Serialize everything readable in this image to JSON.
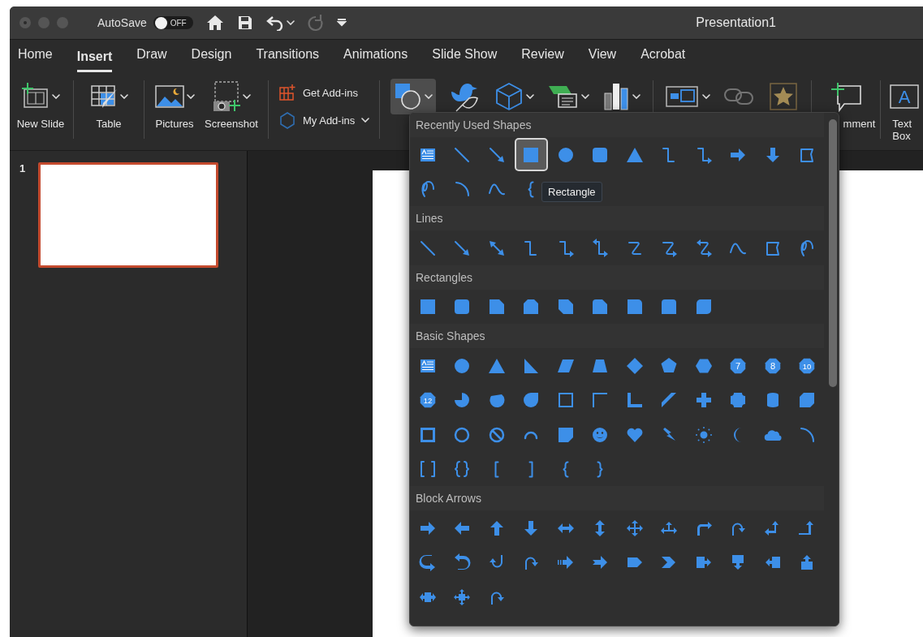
{
  "title_bar": {
    "autosave": {
      "label": "AutoSave",
      "toggle_text": "OFF",
      "on": false
    },
    "quick_access": [
      {
        "kind": "home",
        "disabled": false
      },
      {
        "kind": "save",
        "disabled": false
      },
      {
        "kind": "undo",
        "disabled": false,
        "menu": true
      },
      {
        "kind": "redo",
        "disabled": true,
        "menu": false
      },
      {
        "kind": "customize",
        "disabled": false
      }
    ],
    "title": "Presentation1"
  },
  "tabs": [
    {
      "label": "Home",
      "selected": false
    },
    {
      "label": "Insert",
      "selected": true
    },
    {
      "label": "Draw",
      "selected": false
    },
    {
      "label": "Design",
      "selected": false
    },
    {
      "label": "Transitions",
      "selected": false
    },
    {
      "label": "Animations",
      "selected": false
    },
    {
      "label": "Slide Show",
      "selected": false
    },
    {
      "label": "Review",
      "selected": false
    },
    {
      "label": "View",
      "selected": false
    },
    {
      "label": "Acrobat",
      "selected": false
    }
  ],
  "ribbon": [
    {
      "kind": "new-slide",
      "label": "New Slide",
      "menu": true,
      "selected": false,
      "disabled": false
    },
    {
      "kind": "separator"
    },
    {
      "kind": "table",
      "label": "Table",
      "menu": true,
      "selected": false,
      "disabled": false
    },
    {
      "kind": "separator"
    },
    {
      "kind": "pictures",
      "label": "Pictures",
      "menu": true,
      "selected": false,
      "disabled": false
    },
    {
      "kind": "screenshot",
      "label": "Screenshot",
      "menu": true,
      "selected": false,
      "disabled": false
    },
    {
      "kind": "separator"
    },
    {
      "kind": "addins",
      "items": [
        {
          "kind": "store",
          "label": "Get Add-ins",
          "menu": false
        },
        {
          "kind": "my-addins",
          "label": "My Add-ins",
          "menu": true
        }
      ]
    },
    {
      "kind": "separator"
    },
    {
      "kind": "shapes",
      "menu": true,
      "selected": true,
      "disabled": false
    },
    {
      "kind": "icons",
      "menu": false,
      "selected": false,
      "disabled": false
    },
    {
      "kind": "models",
      "menu": true,
      "selected": false,
      "disabled": false
    },
    {
      "kind": "smartart",
      "menu": true,
      "selected": false,
      "disabled": false
    },
    {
      "kind": "chart",
      "menu": true,
      "selected": false,
      "disabled": false
    },
    {
      "kind": "separator"
    },
    {
      "kind": "media",
      "menu": true,
      "selected": false,
      "disabled": false
    },
    {
      "kind": "link",
      "menu": false,
      "selected": false,
      "disabled": true
    },
    {
      "kind": "action",
      "menu": false,
      "selected": false,
      "disabled": false
    },
    {
      "kind": "separator"
    },
    {
      "kind": "comment",
      "label": "mment",
      "menu": false,
      "selected": false,
      "disabled": false
    },
    {
      "kind": "separator"
    },
    {
      "kind": "text-box",
      "label": "Text Box",
      "glyph": "A",
      "menu": false,
      "selected": false,
      "disabled": false
    }
  ],
  "slides_panel": {
    "slides": [
      {
        "number": "1",
        "selected": true
      }
    ]
  },
  "shapes_gallery": {
    "tooltip": "Rectangle",
    "sections": [
      {
        "title": "Recently Used Shapes",
        "shapes": [
          {
            "kind": "text-box",
            "selected": false
          },
          {
            "kind": "line",
            "selected": false
          },
          {
            "kind": "arrow-line",
            "selected": false
          },
          {
            "kind": "rectangle",
            "selected": true
          },
          {
            "kind": "oval",
            "selected": false
          },
          {
            "kind": "rounded-rectangle",
            "selected": false
          },
          {
            "kind": "triangle",
            "selected": false
          },
          {
            "kind": "elbow-connector",
            "selected": false
          },
          {
            "kind": "elbow-arrow",
            "selected": false
          },
          {
            "kind": "right-arrow",
            "selected": false
          },
          {
            "kind": "down-arrow",
            "selected": false
          },
          {
            "kind": "freeform",
            "selected": false
          },
          {
            "kind": "scribble",
            "selected": false
          },
          {
            "kind": "arc",
            "selected": false
          },
          {
            "kind": "curve",
            "selected": false
          },
          {
            "kind": "left-brace",
            "selected": false
          }
        ]
      },
      {
        "title": "Lines",
        "shapes": [
          {
            "kind": "line",
            "selected": false
          },
          {
            "kind": "arrow-line",
            "selected": false
          },
          {
            "kind": "double-arrow-line",
            "selected": false
          },
          {
            "kind": "elbow-connector",
            "selected": false
          },
          {
            "kind": "elbow-arrow",
            "selected": false
          },
          {
            "kind": "elbow-double-arrow",
            "selected": false
          },
          {
            "kind": "curved-connector",
            "selected": false
          },
          {
            "kind": "curved-arrow-connector",
            "selected": false
          },
          {
            "kind": "curved-double-arrow",
            "selected": false
          },
          {
            "kind": "curve",
            "selected": false
          },
          {
            "kind": "freeform",
            "selected": false
          },
          {
            "kind": "scribble",
            "selected": false
          }
        ]
      },
      {
        "title": "Rectangles",
        "shapes": [
          {
            "kind": "rectangle",
            "selected": false
          },
          {
            "kind": "rounded-rectangle",
            "selected": false
          },
          {
            "kind": "snip-corner",
            "selected": false
          },
          {
            "kind": "snip-same",
            "selected": false
          },
          {
            "kind": "snip-diagonal",
            "selected": false
          },
          {
            "kind": "snip-round",
            "selected": false
          },
          {
            "kind": "round-corner",
            "selected": false
          },
          {
            "kind": "round-same",
            "selected": false
          },
          {
            "kind": "round-diagonal",
            "selected": false
          }
        ]
      },
      {
        "title": "Basic Shapes",
        "shapes": [
          {
            "kind": "text-box",
            "selected": false
          },
          {
            "kind": "oval",
            "selected": false
          },
          {
            "kind": "triangle",
            "selected": false
          },
          {
            "kind": "right-triangle",
            "selected": false
          },
          {
            "kind": "parallelogram",
            "selected": false
          },
          {
            "kind": "trapezoid",
            "selected": false
          },
          {
            "kind": "diamond",
            "selected": false
          },
          {
            "kind": "pentagon",
            "selected": false
          },
          {
            "kind": "hexagon",
            "selected": false
          },
          {
            "kind": "polygon",
            "label": "7",
            "selected": false
          },
          {
            "kind": "polygon",
            "label": "8",
            "selected": false
          },
          {
            "kind": "polygon",
            "label": "10",
            "selected": false
          },
          {
            "kind": "polygon",
            "label": "12",
            "selected": false
          },
          {
            "kind": "pie",
            "selected": false
          },
          {
            "kind": "chord",
            "selected": false
          },
          {
            "kind": "teardrop",
            "selected": false
          },
          {
            "kind": "frame",
            "selected": false
          },
          {
            "kind": "half-frame",
            "selected": false
          },
          {
            "kind": "l-shape",
            "selected": false
          },
          {
            "kind": "diagonal-stripe",
            "selected": false
          },
          {
            "kind": "cross",
            "selected": false
          },
          {
            "kind": "plaque",
            "selected": false
          },
          {
            "kind": "can",
            "selected": false
          },
          {
            "kind": "cube",
            "selected": false
          },
          {
            "kind": "bevel",
            "selected": false
          },
          {
            "kind": "donut",
            "selected": false
          },
          {
            "kind": "no-symbol",
            "selected": false
          },
          {
            "kind": "block-arc",
            "selected": false
          },
          {
            "kind": "folded-corner",
            "selected": false
          },
          {
            "kind": "smiley",
            "selected": false
          },
          {
            "kind": "heart",
            "selected": false
          },
          {
            "kind": "lightning",
            "selected": false
          },
          {
            "kind": "sun",
            "selected": false
          },
          {
            "kind": "moon",
            "selected": false
          },
          {
            "kind": "cloud",
            "selected": false
          },
          {
            "kind": "arc",
            "selected": false
          },
          {
            "kind": "double-bracket",
            "selected": false
          },
          {
            "kind": "double-brace",
            "selected": false
          },
          {
            "kind": "left-bracket",
            "selected": false
          },
          {
            "kind": "right-bracket",
            "selected": false
          },
          {
            "kind": "left-brace",
            "selected": false
          },
          {
            "kind": "right-brace",
            "selected": false
          }
        ]
      },
      {
        "title": "Block Arrows",
        "shapes": [
          {
            "kind": "right-arrow",
            "selected": false
          },
          {
            "kind": "left-arrow",
            "selected": false
          },
          {
            "kind": "up-arrow",
            "selected": false
          },
          {
            "kind": "down-arrow",
            "selected": false
          },
          {
            "kind": "left-right-arrow",
            "selected": false
          },
          {
            "kind": "up-down-arrow",
            "selected": false
          },
          {
            "kind": "quad-arrow",
            "selected": false
          },
          {
            "kind": "left-right-up-arrow",
            "selected": false
          },
          {
            "kind": "bent-arrow",
            "selected": false
          },
          {
            "kind": "u-turn-arrow",
            "selected": false
          },
          {
            "kind": "left-up-arrow",
            "selected": false
          },
          {
            "kind": "bent-up-arrow",
            "selected": false
          },
          {
            "kind": "curved-right-arrow",
            "selected": false
          },
          {
            "kind": "curved-left-arrow",
            "selected": false
          },
          {
            "kind": "curved-up-arrow",
            "selected": false
          },
          {
            "kind": "curved-down-arrow",
            "selected": false
          },
          {
            "kind": "striped-right-arrow",
            "selected": false
          },
          {
            "kind": "notched-right-arrow",
            "selected": false
          },
          {
            "kind": "pentagon-arrow",
            "selected": false
          },
          {
            "kind": "chevron",
            "selected": false
          },
          {
            "kind": "right-callout",
            "selected": false
          },
          {
            "kind": "down-callout",
            "selected": false
          },
          {
            "kind": "left-callout",
            "selected": false
          },
          {
            "kind": "up-callout",
            "selected": false
          },
          {
            "kind": "left-right-callout",
            "selected": false
          },
          {
            "kind": "quad-callout",
            "selected": false
          },
          {
            "kind": "circular-arrow",
            "selected": false
          }
        ]
      }
    ]
  }
}
